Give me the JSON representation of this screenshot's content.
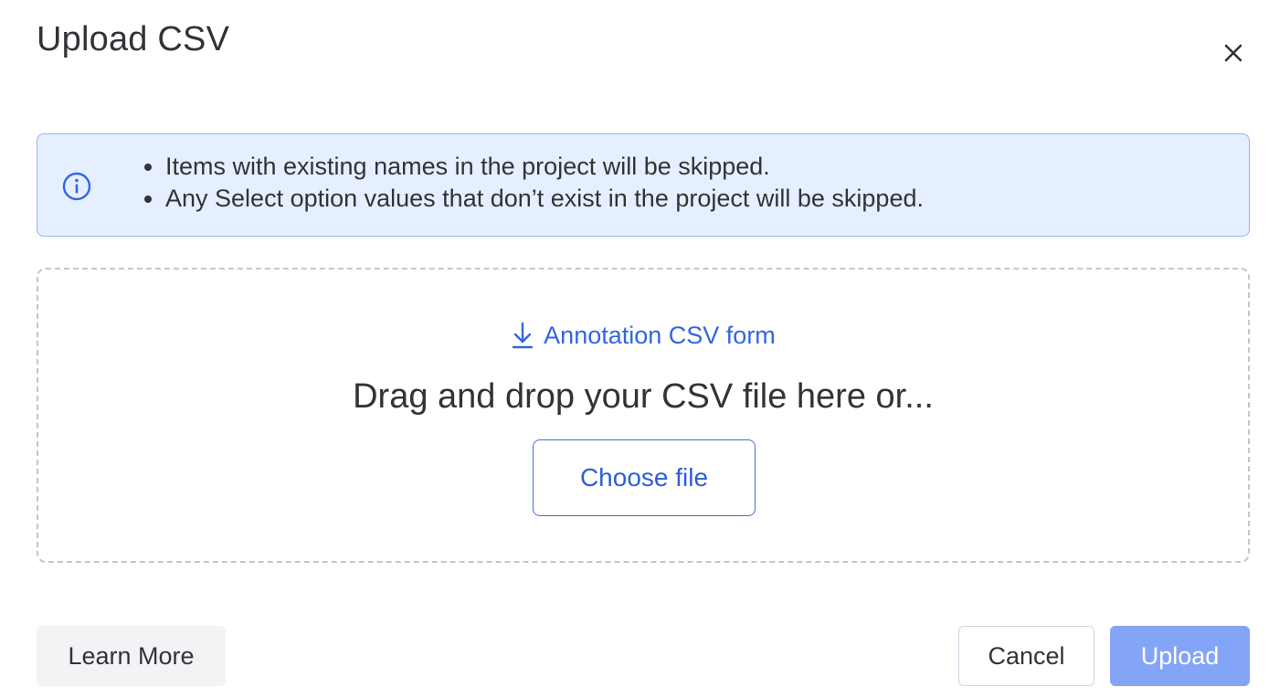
{
  "dialog": {
    "title": "Upload CSV",
    "close_icon": "close-icon"
  },
  "info": {
    "icon": "info-icon",
    "items": [
      "Items with existing names in the project will be skipped.",
      "Any Select option values that don’t exist in the project will be skipped."
    ]
  },
  "dropzone": {
    "download_icon": "download-arrow-icon",
    "download_label": "Annotation CSV form",
    "drop_text": "Drag and drop your CSV file here or...",
    "choose_label": "Choose file"
  },
  "footer": {
    "learn_more_label": "Learn More",
    "cancel_label": "Cancel",
    "upload_label": "Upload",
    "upload_enabled": false
  },
  "colors": {
    "accent": "#3366e0",
    "info_background": "#e6efff",
    "info_border": "#93b4f5",
    "upload_disabled": "#84a4f7",
    "text": "#323338"
  }
}
